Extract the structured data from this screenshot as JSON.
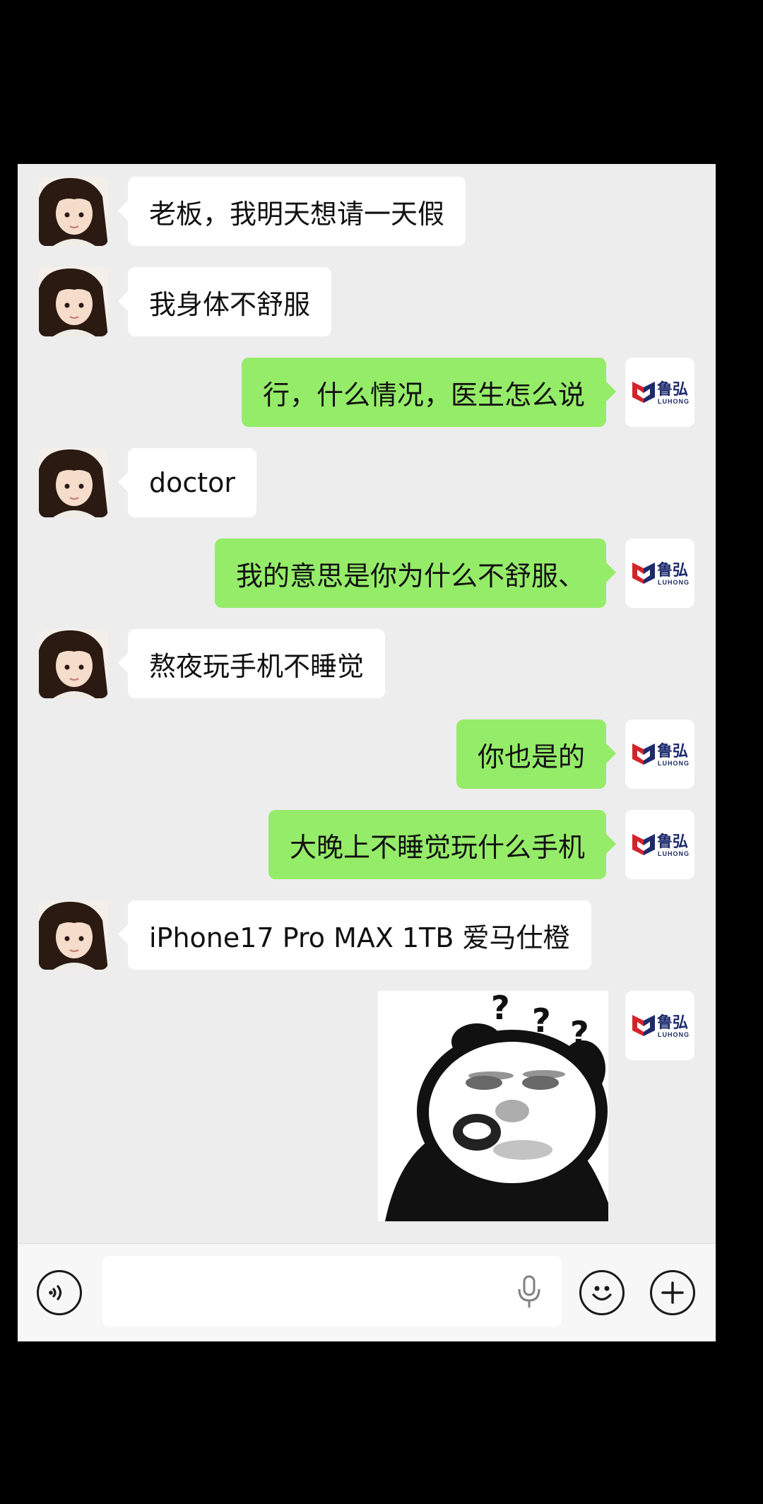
{
  "messages": [
    {
      "side": "left",
      "text": "老板，我明天想请一天假"
    },
    {
      "side": "left",
      "text": "我身体不舒服"
    },
    {
      "side": "right",
      "text": "行，什么情况，医生怎么说"
    },
    {
      "side": "left",
      "text": "doctor"
    },
    {
      "side": "right",
      "text": "我的意思是你为什么不舒服、"
    },
    {
      "side": "left",
      "text": "熬夜玩手机不睡觉"
    },
    {
      "side": "right",
      "text": "你也是的"
    },
    {
      "side": "right",
      "text": "大晚上不睡觉玩什么手机"
    },
    {
      "side": "left",
      "text": "iPhone17 Pro MAX 1TB 爱马仕橙"
    },
    {
      "side": "right",
      "type": "sticker",
      "sticker": "panda-confused"
    }
  ],
  "sender_logo": {
    "cn": "鲁弘",
    "en": "LUHONG"
  },
  "colors": {
    "self_bubble": "#95ec69",
    "other_bubble": "#ffffff",
    "chat_bg": "#ededed",
    "logo_red": "#d3242b",
    "logo_blue": "#1d2a6b"
  },
  "input_bar": {
    "placeholder": "",
    "icons": [
      "voice-icon",
      "mic-icon",
      "emoji-icon",
      "plus-icon"
    ]
  }
}
